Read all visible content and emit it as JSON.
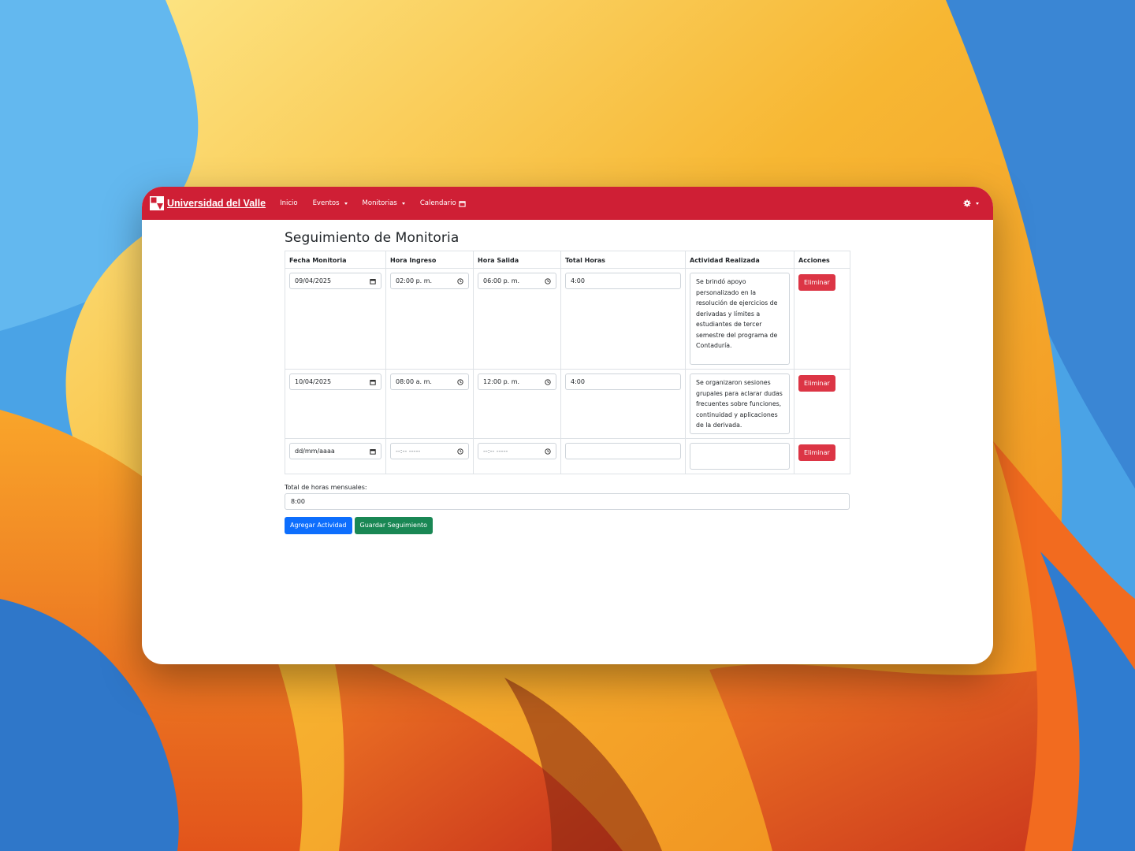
{
  "navbar": {
    "brand": "Universidad del Valle",
    "items": [
      {
        "label": "Inicio",
        "dropdown": false
      },
      {
        "label": "Eventos",
        "dropdown": true
      },
      {
        "label": "Monitorias",
        "dropdown": true
      },
      {
        "label": "Calendario",
        "dropdown": false,
        "icon": "calendar-icon"
      }
    ],
    "settings_icon": "gear-icon",
    "accent_color": "#cf1f35"
  },
  "page": {
    "title": "Seguimiento de Monitoria"
  },
  "table": {
    "headers": [
      "Fecha Monitoria",
      "Hora Ingreso",
      "Hora Salida",
      "Total Horas",
      "Actividad Realizada",
      "Acciones"
    ],
    "rows": [
      {
        "fecha": "09/04/2025",
        "ingreso": "02:00 p. m.",
        "salida": "06:00 p. m.",
        "total": "4:00",
        "actividad": "Se brindó apoyo personalizado en la resolución de ejercicios de derivadas y límites a estudiantes de tercer semestre del programa de Contaduría.",
        "accion": "Eliminar"
      },
      {
        "fecha": "10/04/2025",
        "ingreso": "08:00 a. m.",
        "salida": "12:00 p. m.",
        "total": "4:00",
        "actividad": "Se organizaron sesiones grupales para aclarar dudas frecuentes sobre funciones, continuidad y aplicaciones de la derivada.",
        "accion": "Eliminar"
      },
      {
        "fecha_placeholder": "dd/mm/aaaa",
        "ingreso_placeholder": "--:-- -----",
        "salida_placeholder": "--:-- -----",
        "total": "",
        "actividad": "",
        "accion": "Eliminar"
      }
    ]
  },
  "summary": {
    "label": "Total de horas mensuales:",
    "value": "8:00"
  },
  "buttons": {
    "add": "Agregar Actividad",
    "save": "Guardar Seguimiento"
  }
}
